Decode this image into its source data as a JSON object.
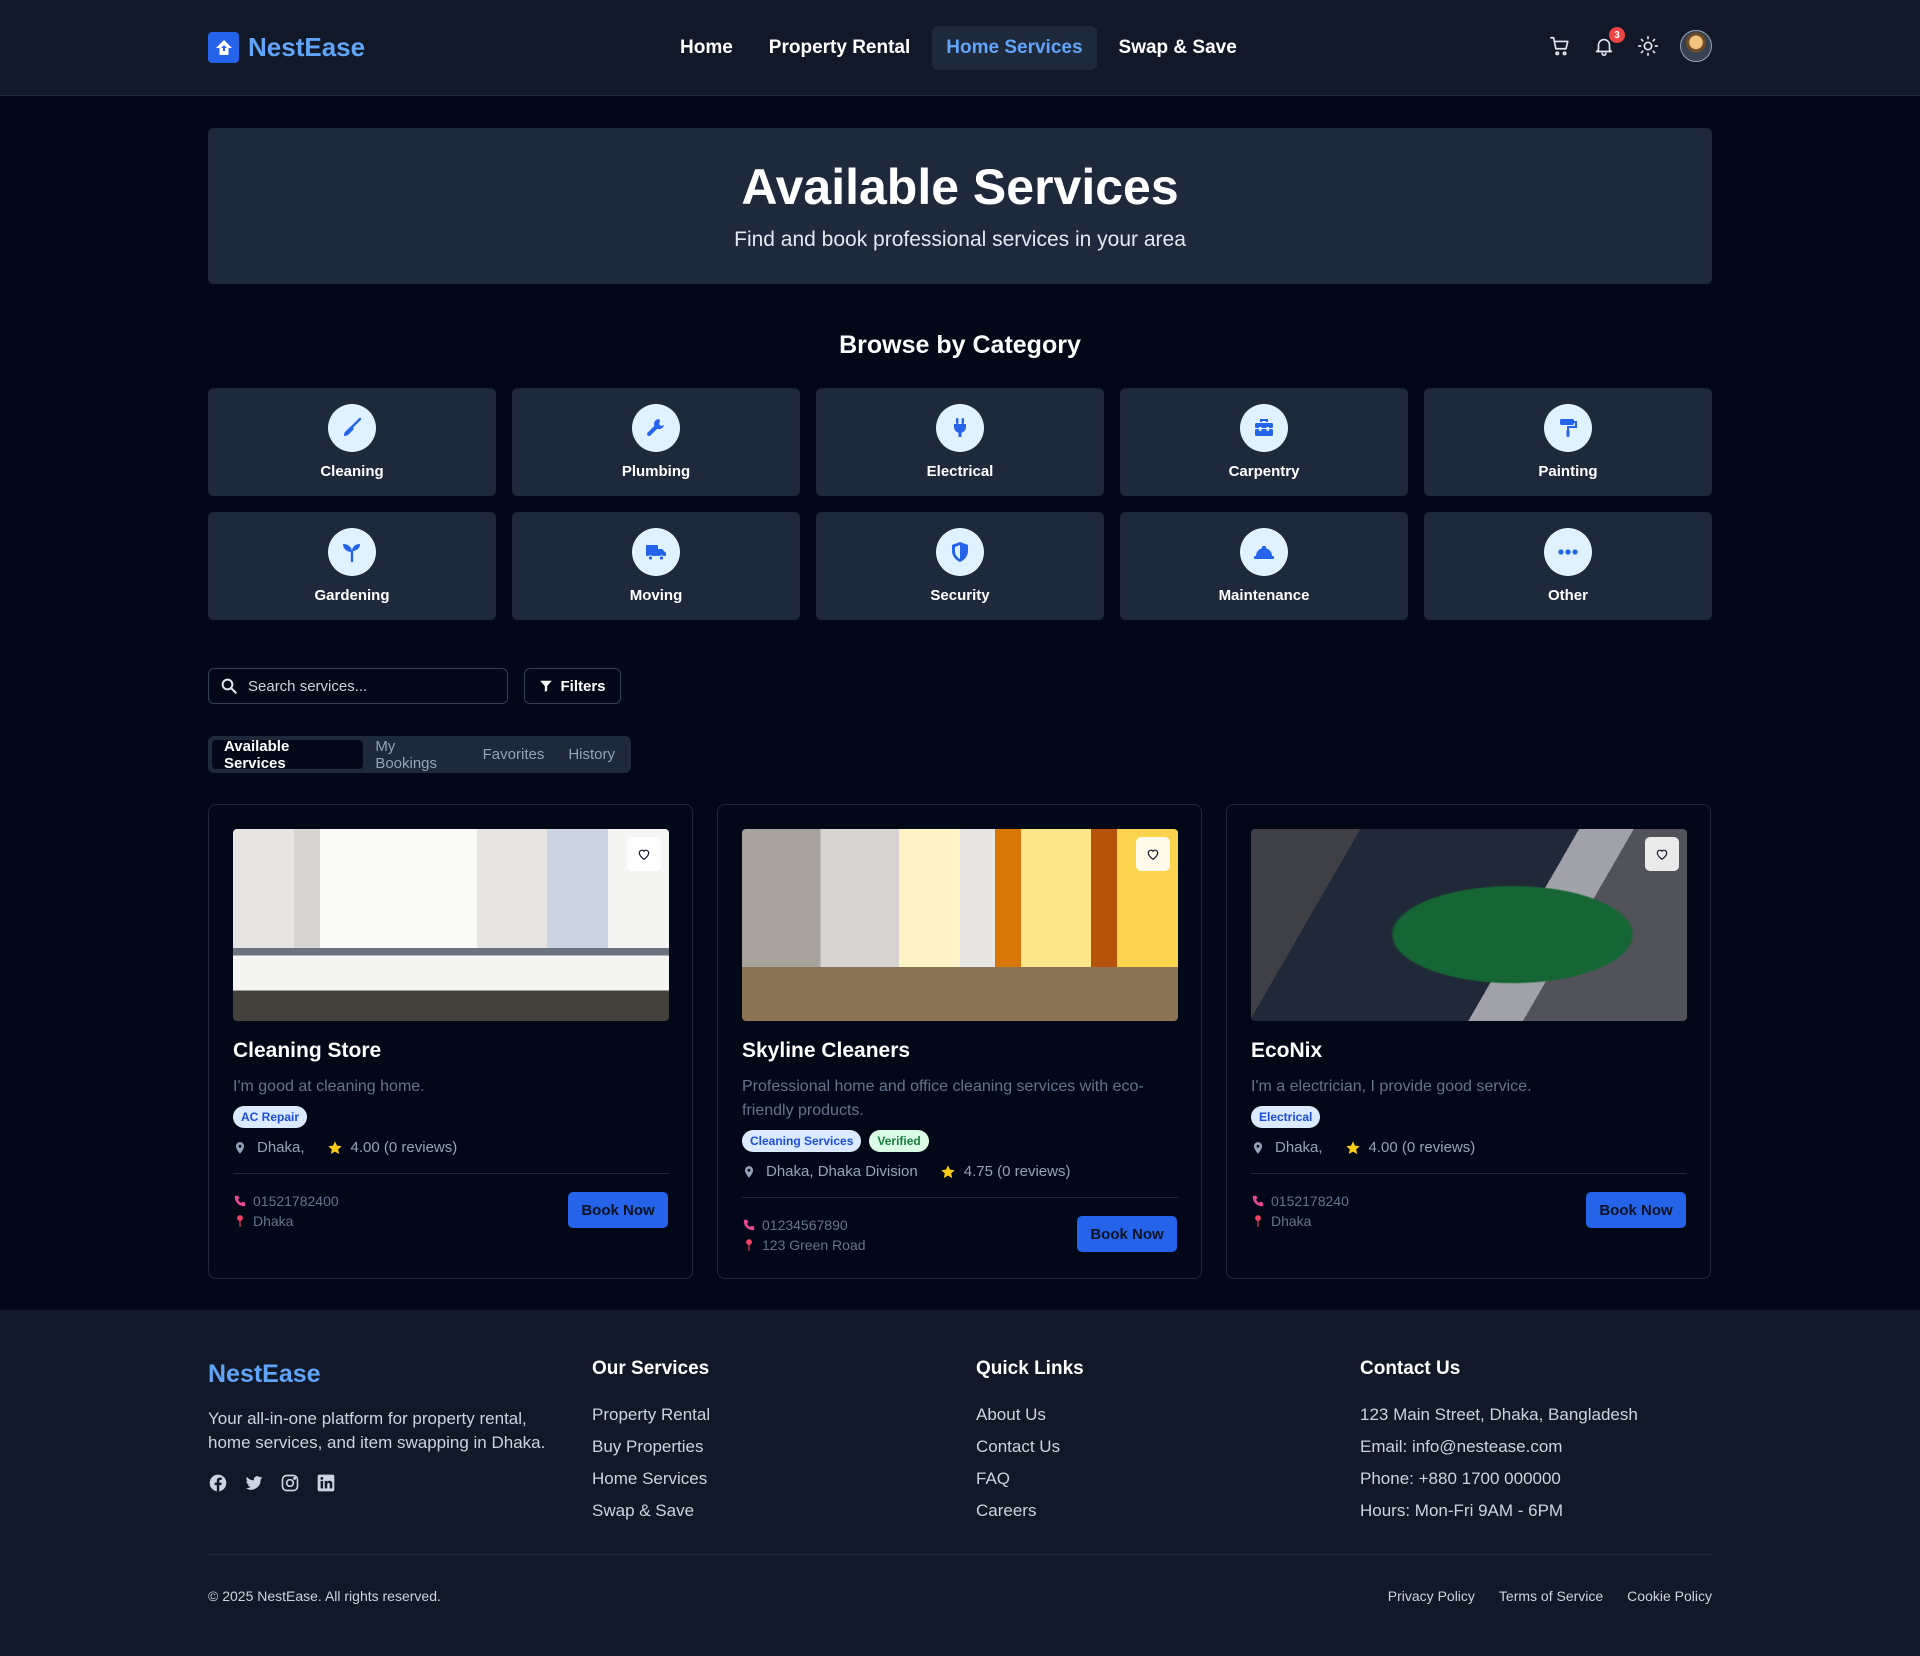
{
  "brand": {
    "name": "NestEase",
    "accent": "#60a5fa",
    "primary": "#2563eb"
  },
  "nav": [
    {
      "label": "Home"
    },
    {
      "label": "Property Rental"
    },
    {
      "label": "Home Services",
      "active": true
    },
    {
      "label": "Swap & Save"
    }
  ],
  "header": {
    "notification_count": "3",
    "icons": [
      "cart-icon",
      "bell-icon",
      "sun-icon",
      "avatar"
    ]
  },
  "hero": {
    "title": "Available Services",
    "subtitle": "Find and book professional services in your area"
  },
  "categories": {
    "title": "Browse by Category",
    "items": [
      {
        "label": "Cleaning",
        "icon": "broom-icon"
      },
      {
        "label": "Plumbing",
        "icon": "wrench-icon"
      },
      {
        "label": "Electrical",
        "icon": "plug-icon"
      },
      {
        "label": "Carpentry",
        "icon": "toolbox-icon"
      },
      {
        "label": "Painting",
        "icon": "paint-roller-icon"
      },
      {
        "label": "Gardening",
        "icon": "seedling-icon"
      },
      {
        "label": "Moving",
        "icon": "truck-icon"
      },
      {
        "label": "Security",
        "icon": "shield-icon"
      },
      {
        "label": "Maintenance",
        "icon": "hard-hat-icon"
      },
      {
        "label": "Other",
        "icon": "more-icon"
      }
    ]
  },
  "search": {
    "placeholder": "Search services...",
    "filters_label": "Filters"
  },
  "tabs": [
    {
      "label": "Available Services",
      "active": true
    },
    {
      "label": "My Bookings"
    },
    {
      "label": "Favorites"
    },
    {
      "label": "History"
    }
  ],
  "services": [
    {
      "name": "Cleaning Store",
      "description": "I'm good at cleaning home.",
      "tags": [
        {
          "label": "AC Repair",
          "color": "blue"
        }
      ],
      "location": "Dhaka,",
      "rating": "4.00 (0 reviews)",
      "phone": "01521782400",
      "address": "Dhaka",
      "book_label": "Book Now"
    },
    {
      "name": "Skyline Cleaners",
      "description": "Professional home and office cleaning services with eco-friendly products.",
      "tags": [
        {
          "label": "Cleaning Services",
          "color": "blue"
        },
        {
          "label": "Verified",
          "color": "green"
        }
      ],
      "location": "Dhaka, Dhaka Division",
      "rating": "4.75 (0 reviews)",
      "phone": "01234567890",
      "address": "123 Green Road",
      "book_label": "Book Now"
    },
    {
      "name": "EcoNix",
      "description": "I'm a electrician, I provide good service.",
      "tags": [
        {
          "label": "Electrical",
          "color": "blue"
        }
      ],
      "location": "Dhaka,",
      "rating": "4.00 (0 reviews)",
      "phone": "0152178240",
      "address": "Dhaka",
      "book_label": "Book Now"
    }
  ],
  "footer": {
    "brand": "NestEase",
    "about": "Your all-in-one platform for property rental, home services, and item swapping in Dhaka.",
    "services": {
      "title": "Our Services",
      "links": [
        "Property Rental",
        "Buy Properties",
        "Home Services",
        "Swap & Save"
      ]
    },
    "quick_links": {
      "title": "Quick Links",
      "links": [
        "About Us",
        "Contact Us",
        "FAQ",
        "Careers"
      ]
    },
    "contact": {
      "title": "Contact Us",
      "lines": [
        "123 Main Street, Dhaka, Bangladesh",
        "Email: info@nestease.com",
        "Phone: +880 1700 000000",
        "Hours: Mon-Fri 9AM - 6PM"
      ]
    },
    "copyright": "© 2025 NestEase. All rights reserved.",
    "legal": [
      "Privacy Policy",
      "Terms of Service",
      "Cookie Policy"
    ]
  }
}
